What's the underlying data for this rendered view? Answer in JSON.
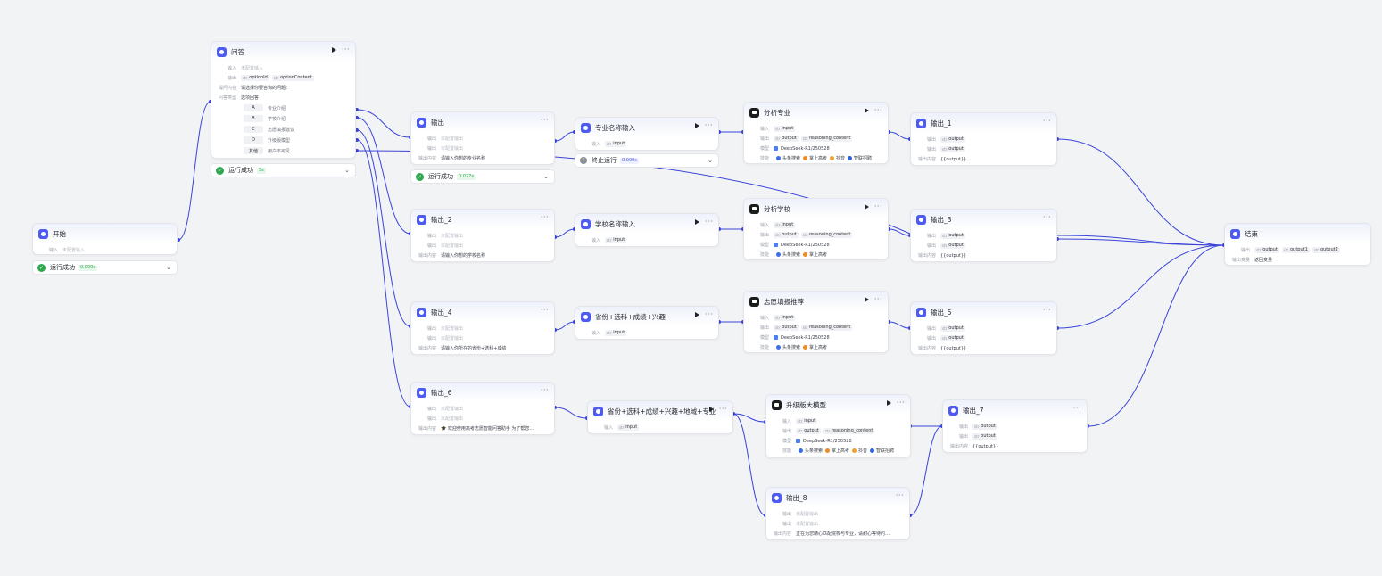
{
  "colors": {
    "accent": "#4d5bf0",
    "edge": "#3a44d8",
    "success": "#2ea84f"
  },
  "nodes": {
    "start": {
      "title": "开始",
      "input_label": "输入",
      "input_value": "未配置输入"
    },
    "qa": {
      "title": "问答",
      "input_label": "输入",
      "input_value": "未配置输入",
      "output_label": "输出",
      "outputs": [
        "optionId",
        "optionContent"
      ],
      "question_label": "提问内容",
      "question_value": "请选择你要咨询的问题：",
      "answer_type_label": "问答类型",
      "answer_type_value": "选项回答",
      "options": [
        {
          "key": "A",
          "text": "专业介绍"
        },
        {
          "key": "B",
          "text": "学校介绍"
        },
        {
          "key": "C",
          "text": "志愿填报建议"
        },
        {
          "key": "D",
          "text": "升级版模型"
        },
        {
          "key": "其他",
          "text": "用户不可见"
        }
      ]
    },
    "out0": {
      "title": "输出",
      "row1_label": "输出",
      "row1_value": "未配置输出",
      "row2_label": "输出",
      "row2_value": "未配置输出",
      "content_label": "输出内容",
      "content_value": "请输入你想的专业名称"
    },
    "out2": {
      "title": "输出_2",
      "row1_label": "输出",
      "row1_value": "未配置输出",
      "row2_label": "输出",
      "row2_value": "未配置输出",
      "content_label": "输出内容",
      "content_value": "请输入你想的学校名称"
    },
    "out4": {
      "title": "输出_4",
      "row1_label": "输出",
      "row1_value": "未配置输出",
      "row2_label": "输出",
      "row2_value": "未配置输出",
      "content_label": "输出内容",
      "content_value": "请输入你所在的省份+选科+成绩"
    },
    "out6": {
      "title": "输出_6",
      "row1_label": "输出",
      "row1_value": "未配置输出",
      "row2_label": "输出",
      "row2_value": "未配置输出",
      "content_label": "输出内容",
      "content_value": "🎓 欢迎使用高考志愿智能问答助手 为了帮您…"
    },
    "in_major": {
      "title": "专业名称输入",
      "label": "输入",
      "chip": "input"
    },
    "in_school": {
      "title": "学校名称输入",
      "label": "输入",
      "chip": "input"
    },
    "in_province": {
      "title": "省份+选科+成绩+兴趣",
      "label": "输入",
      "chip": "input"
    },
    "in_full": {
      "title": "省份+选科+成绩+兴趣+地域+专业",
      "label": "输入",
      "chip": "input"
    },
    "llm_major": {
      "title": "分析专业",
      "in_label": "输入",
      "in_chip": "input",
      "out_label": "输出",
      "out_chips": [
        "output",
        "reasoning_content"
      ],
      "model_label": "模型",
      "model": "DeepSeek-R1/250528",
      "skill_label": "技能",
      "skills": [
        "头条搜索",
        "掌上高考",
        "抖音",
        "智联招聘"
      ]
    },
    "llm_school": {
      "title": "分析学校",
      "in_label": "输入",
      "in_chip": "input",
      "out_label": "输出",
      "out_chips": [
        "output",
        "reasoning_content"
      ],
      "model_label": "模型",
      "model": "DeepSeek-R1/250528",
      "skill_label": "技能",
      "skills": [
        "头条搜索",
        "掌上高考"
      ]
    },
    "llm_advice": {
      "title": "志愿填报推荐",
      "in_label": "输入",
      "in_chip": "input",
      "out_label": "输出",
      "out_chips": [
        "output",
        "reasoning_content"
      ],
      "model_label": "模型",
      "model": "DeepSeek-R1/250528",
      "skill_label": "技能",
      "skills": [
        "头条搜索",
        "掌上高考"
      ]
    },
    "llm_upgrade": {
      "title": "升级版大模型",
      "in_label": "输入",
      "in_chip": "input",
      "out_label": "输出",
      "out_chips": [
        "output",
        "reasoning_content"
      ],
      "model_label": "模型",
      "model": "DeepSeek-R1/250528",
      "skill_label": "技能",
      "skills": [
        "头条搜索",
        "掌上高考",
        "抖音",
        "智联招聘"
      ]
    },
    "out1": {
      "title": "输出_1",
      "row1_label": "输出",
      "row1_chip": "output",
      "row2_label": "输出",
      "row2_chip": "output",
      "content_label": "输出内容",
      "content_value": "{{output}}"
    },
    "out3": {
      "title": "输出_3",
      "row1_label": "输出",
      "row1_chip": "output",
      "row2_label": "输出",
      "row2_chip": "output",
      "content_label": "输出内容",
      "content_value": "{{output}}"
    },
    "out5": {
      "title": "输出_5",
      "row1_label": "输出",
      "row1_chip": "output",
      "row2_label": "输出",
      "row2_chip": "output",
      "content_label": "输出内容",
      "content_value": "{{output}}"
    },
    "out7": {
      "title": "输出_7",
      "row1_label": "输出",
      "row1_chip": "output",
      "row2_label": "输出",
      "row2_chip": "output",
      "content_label": "输出内容",
      "content_value": "{{output}}"
    },
    "out8": {
      "title": "输出_8",
      "row1_label": "输出",
      "row1_value": "未配置输出",
      "row2_label": "输出",
      "row2_value": "未配置输出",
      "content_label": "输出内容",
      "content_value": "正在为您精心匹配院校与专业，请耐心等待约…"
    },
    "end": {
      "title": "结束",
      "out_label": "输出",
      "out_chips": [
        "output",
        "output1",
        "output2"
      ],
      "var_label": "输出变量",
      "var_value": "返回变量"
    }
  },
  "statuses": {
    "start": {
      "text": "运行成功",
      "time": "0.000s"
    },
    "qa": {
      "text": "运行成功",
      "time": "5s"
    },
    "out0": {
      "text": "运行成功",
      "time": "0.027s"
    },
    "in_major": {
      "text": "终止运行",
      "time": "0.000s"
    }
  },
  "chip_type": "str"
}
